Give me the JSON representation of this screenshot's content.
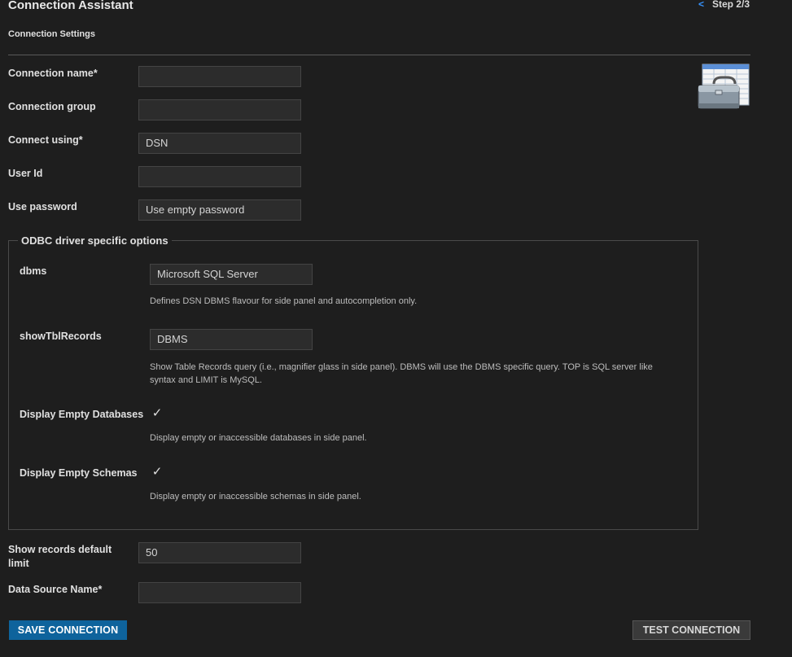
{
  "header": {
    "title": "Connection Assistant",
    "subtitle": "Connection Settings",
    "back_icon": "<",
    "step": "Step 2/3"
  },
  "form": {
    "connection_name": {
      "label": "Connection name*",
      "value": ""
    },
    "connection_group": {
      "label": "Connection group",
      "value": ""
    },
    "connect_using": {
      "label": "Connect using*",
      "value": "DSN"
    },
    "user_id": {
      "label": "User Id",
      "value": ""
    },
    "use_password": {
      "label": "Use password",
      "value": "Use empty password"
    }
  },
  "odbc": {
    "legend": "ODBC driver specific options",
    "dbms": {
      "label": "dbms",
      "value": "Microsoft SQL Server",
      "description": "Defines DSN DBMS flavour for side panel and autocompletion only."
    },
    "show_tbl_records": {
      "label": "showTblRecords",
      "value": "DBMS",
      "description_line1": "Show Table Records query (i.e., magnifier glass in side panel). DBMS will use the DBMS specific query. TOP is SQL server like",
      "description_line2": "syntax and LIMIT is MySQL."
    },
    "display_empty_databases": {
      "label": "Display Empty Databases",
      "checked": true,
      "check_glyph": "✓",
      "description": "Display empty or inaccessible databases in side panel."
    },
    "display_empty_schemas": {
      "label": "Display Empty Schemas",
      "checked": true,
      "check_glyph": "✓",
      "description": "Display empty or inaccessible schemas in side panel."
    }
  },
  "extra": {
    "show_records_limit": {
      "label_line1": "Show records default",
      "label_line2": "limit",
      "value": "50"
    },
    "data_source_name": {
      "label": "Data Source Name*",
      "value": ""
    }
  },
  "buttons": {
    "save": "SAVE CONNECTION",
    "test": "TEST CONNECTION"
  },
  "icons": {
    "toolbox": "toolbox-icon"
  },
  "colors": {
    "background": "#1e1e1e",
    "primary_button": "#0e639c",
    "link": "#3794ff"
  }
}
